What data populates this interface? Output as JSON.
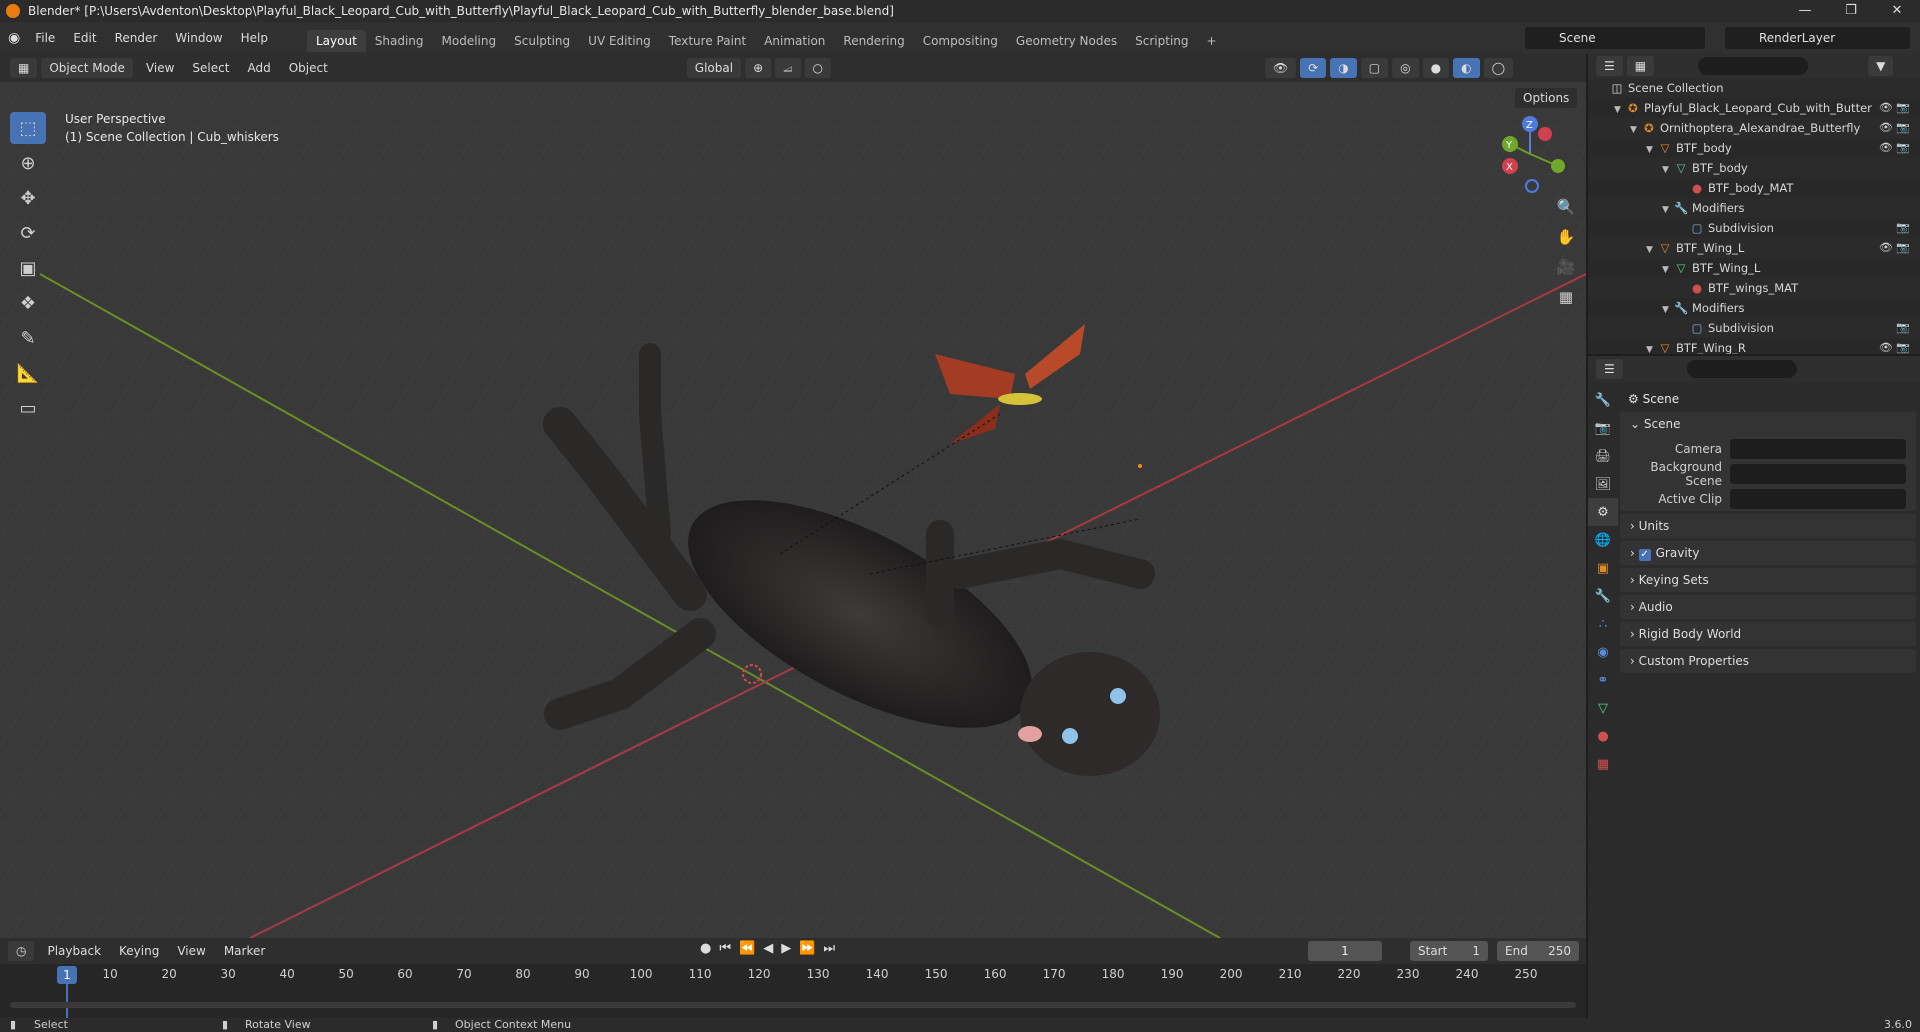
{
  "window": {
    "title": "Blender* [P:\\Users\\Avdenton\\Desktop\\Playful_Black_Leopard_Cub_with_Butterfly\\Playful_Black_Leopard_Cub_with_Butterfly_blender_base.blend]"
  },
  "menus": [
    "File",
    "Edit",
    "Render",
    "Window",
    "Help"
  ],
  "workspaces": [
    "Layout",
    "Shading",
    "Modeling",
    "Sculpting",
    "UV Editing",
    "Texture Paint",
    "Animation",
    "Rendering",
    "Compositing",
    "Geometry Nodes",
    "Scripting"
  ],
  "active_workspace": "Layout",
  "scene_name": "Scene",
  "render_layer": "RenderLayer",
  "viewport": {
    "mode": "Object Mode",
    "menus": [
      "View",
      "Select",
      "Add",
      "Object"
    ],
    "transform_orientation": "Global",
    "options_label": "Options",
    "perspective_label": "User Perspective",
    "collection_label": "(1) Scene Collection | Cub_whiskers"
  },
  "gizmo": {
    "z": "Z",
    "y": "Y",
    "x": "X"
  },
  "timeline": {
    "menus": [
      "Playback",
      "Keying",
      "View",
      "Marker"
    ],
    "ticks": [
      "1",
      "10",
      "20",
      "30",
      "40",
      "50",
      "60",
      "70",
      "80",
      "90",
      "100",
      "110",
      "120",
      "130",
      "140",
      "150",
      "160",
      "170",
      "180",
      "190",
      "200",
      "210",
      "220",
      "230",
      "240",
      "250"
    ],
    "current_frame": "1",
    "start_label": "Start",
    "start_value": "1",
    "end_label": "End",
    "end_value": "250"
  },
  "status": {
    "select": "Select",
    "rotate": "Rotate View",
    "context": "Object Context Menu",
    "version": "3.6.0"
  },
  "outliner": {
    "rows": [
      {
        "label": "Scene Collection",
        "indent": 0
      },
      {
        "label": "Playful_Black_Leopard_Cub_with_Butter",
        "indent": 1
      },
      {
        "label": "Ornithoptera_Alexandrae_Butterfly",
        "indent": 2
      },
      {
        "label": "BTF_body",
        "indent": 3
      },
      {
        "label": "BTF_body",
        "indent": 4
      },
      {
        "label": "BTF_body_MAT",
        "indent": 5
      },
      {
        "label": "Modifiers",
        "indent": 4
      },
      {
        "label": "Subdivision",
        "indent": 5
      },
      {
        "label": "BTF_Wing_L",
        "indent": 3
      },
      {
        "label": "BTF_Wing_L",
        "indent": 4
      },
      {
        "label": "BTF_wings_MAT",
        "indent": 5
      },
      {
        "label": "Modifiers",
        "indent": 4
      },
      {
        "label": "Subdivision",
        "indent": 5
      },
      {
        "label": "BTF_Wing_R",
        "indent": 3
      }
    ]
  },
  "properties": {
    "title": "Scene",
    "scene_panel": "Scene",
    "camera_label": "Camera",
    "background_label": "Background Scene",
    "clip_label": "Active Clip",
    "panels": [
      "Units",
      "Gravity",
      "Keying Sets",
      "Audio",
      "Rigid Body World",
      "Custom Properties"
    ]
  }
}
